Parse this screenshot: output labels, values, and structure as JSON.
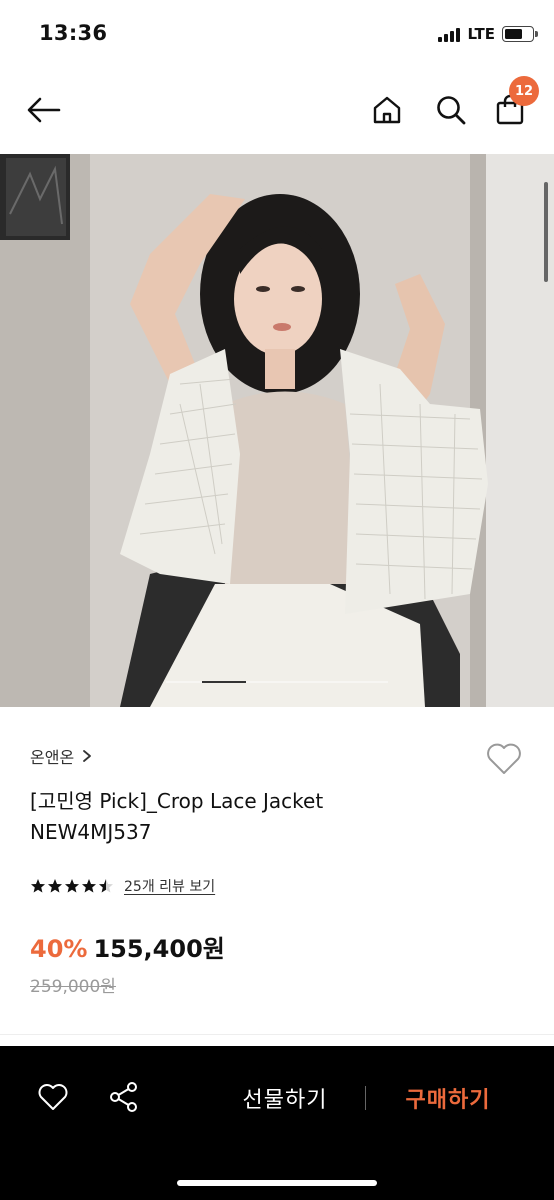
{
  "status_bar": {
    "time": "13:36",
    "network": "LTE",
    "battery_level": 0.65
  },
  "nav": {
    "back_icon": "arrow-left-icon",
    "home_icon": "home-icon",
    "search_icon": "search-icon",
    "bag_icon": "shopping-bag-icon",
    "cart_count": "12"
  },
  "product": {
    "image_description_icon": "product-photo",
    "image_slider_position": 0.2,
    "brand": "온앤온",
    "brand_chevron": "›",
    "title_line1": "[고민영 Pick]_Crop Lace Jacket",
    "title_line2": "NEW4MJ537",
    "rating": 4.5,
    "review_link": "25개 리뷰 보기",
    "discount": "40%",
    "price": "155,400원",
    "original_price": "259,000원"
  },
  "bottom_bar": {
    "wish_icon": "heart-icon",
    "share_icon": "share-icon",
    "gift_label": "선물하기",
    "buy_label": "구매하기"
  },
  "colors": {
    "accent": "#ec6a3c",
    "bottom_bar_bg": "#000000"
  }
}
